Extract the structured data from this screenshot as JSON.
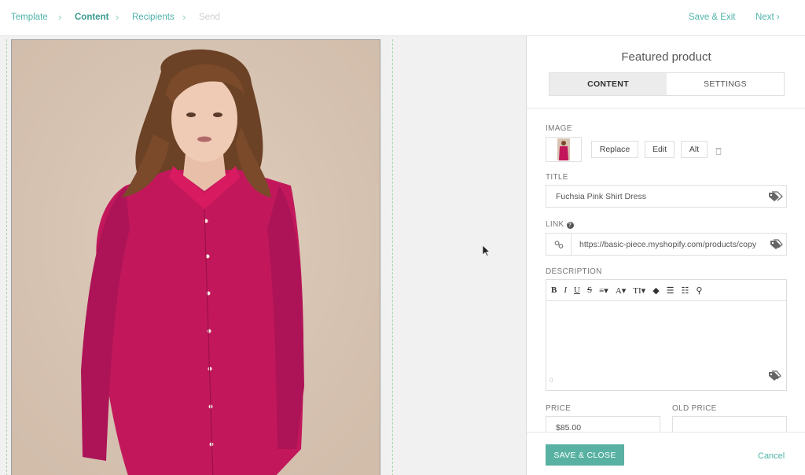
{
  "breadcrumb": {
    "steps": [
      {
        "label": "Template"
      },
      {
        "label": "Content"
      },
      {
        "label": "Recipients"
      },
      {
        "label": "Send"
      }
    ],
    "save_exit": "Save & Exit",
    "next": "Next"
  },
  "panel": {
    "title": "Featured product",
    "tabs": [
      {
        "label": "CONTENT",
        "active": true
      },
      {
        "label": "SETTINGS",
        "active": false
      }
    ],
    "image": {
      "label": "IMAGE",
      "replace": "Replace",
      "edit": "Edit",
      "alt": "Alt"
    },
    "title_field": {
      "label": "TITLE",
      "value": "Fuchsia Pink Shirt Dress"
    },
    "link_field": {
      "label": "LINK",
      "value": "https://basic-piece.myshopify.com/products/copy"
    },
    "description": {
      "label": "DESCRIPTION",
      "toolbar": [
        "B",
        "I",
        "U",
        "S",
        "≡▾",
        "A▾",
        "TI▾",
        "◆",
        "☰",
        "☷",
        "⚲"
      ],
      "value": "",
      "char_count": "0"
    },
    "price": {
      "label": "PRICE",
      "value": "$85.00"
    },
    "old_price": {
      "label": "OLD PRICE",
      "value": ""
    },
    "save_close": "SAVE & CLOSE",
    "cancel": "Cancel"
  },
  "colors": {
    "accent": "#4fb3a9",
    "save_button": "#58b1a2",
    "dress": "#c2185b",
    "photo_background": "#d8c4b3"
  }
}
